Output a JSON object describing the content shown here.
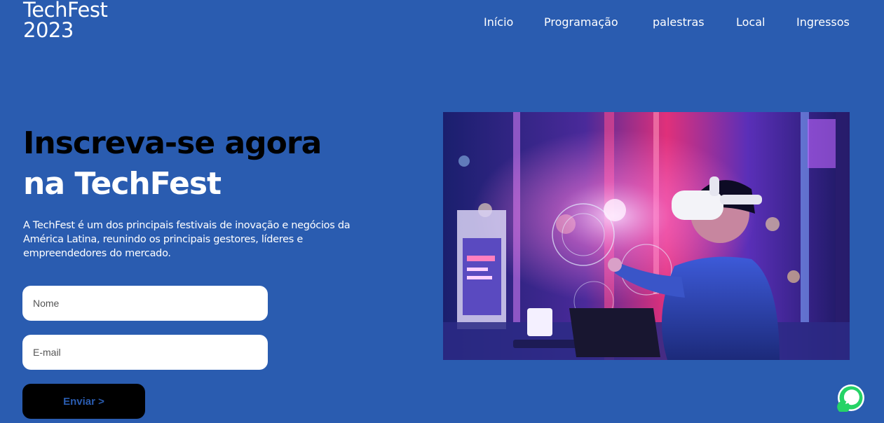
{
  "brand": {
    "line1": "TechFest",
    "line2": "2023"
  },
  "nav": {
    "items": [
      {
        "label": "Início"
      },
      {
        "label": "Programação"
      },
      {
        "label": "palestras"
      },
      {
        "label": "Local"
      },
      {
        "label": "Ingressos"
      }
    ]
  },
  "hero": {
    "headline_line1": "Inscreva-se agora",
    "headline_line2": "na TechFest",
    "description": "A TechFest é um dos principais festivais de inovação e negócios da América Latina, reunindo os principais gestores, líderes e empreendedores do mercado.",
    "image_icon": "vr-headset-person-photo"
  },
  "form": {
    "name_placeholder": "Nome",
    "name_value": "",
    "email_placeholder": "E-mail",
    "email_value": "",
    "submit_label": "Enviar >"
  },
  "floating": {
    "icon": "whatsapp-icon"
  },
  "colors": {
    "background": "#2a5cb0",
    "headline_dark": "#000000",
    "text_light": "#ffffff",
    "button_bg": "#000000",
    "whatsapp_green": "#25d366"
  }
}
